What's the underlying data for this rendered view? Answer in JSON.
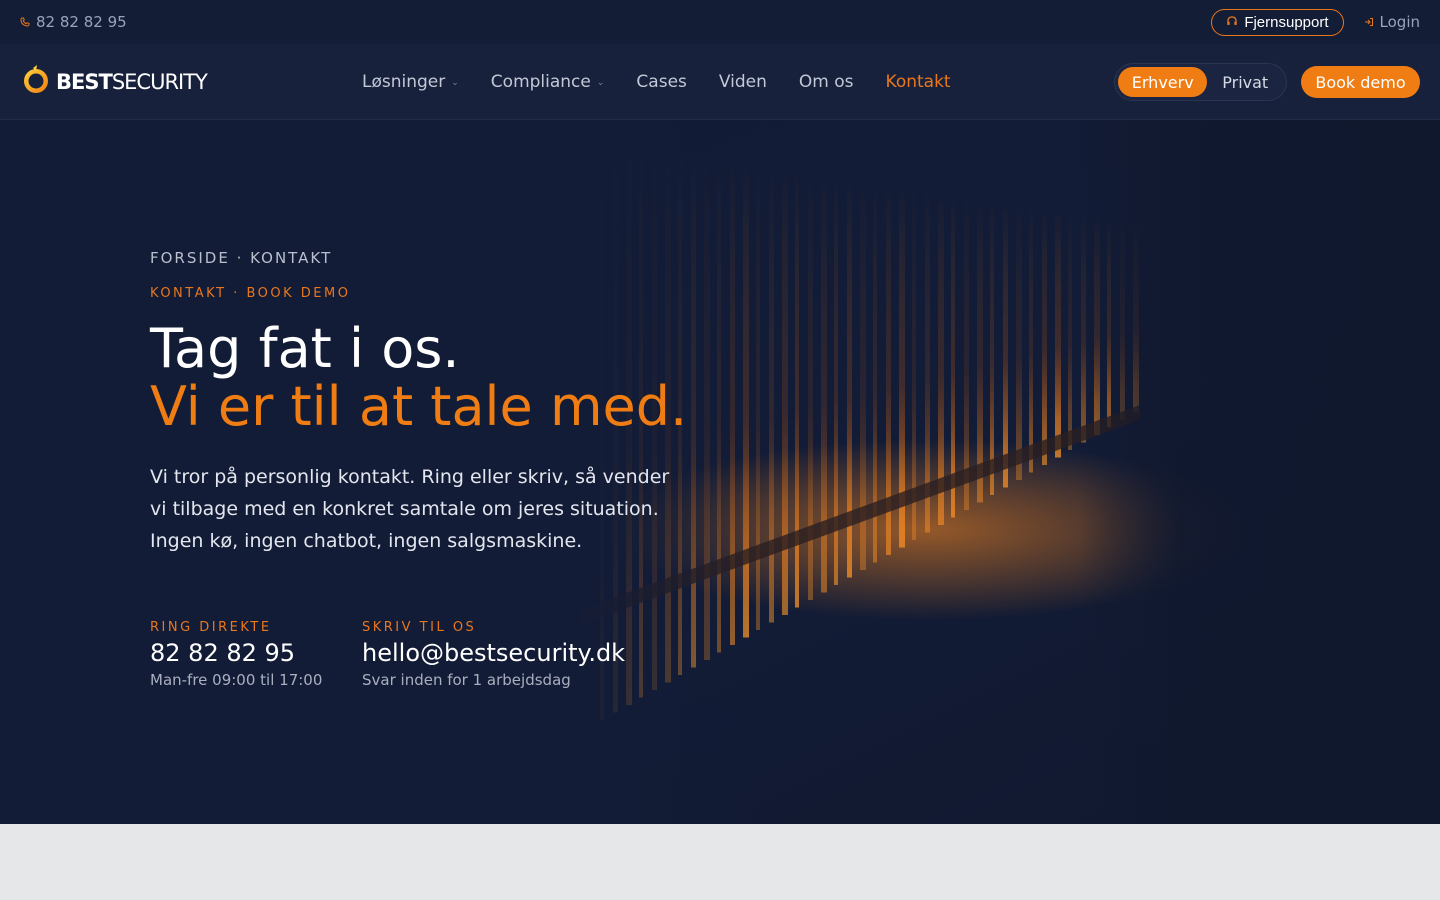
{
  "utility_bar": {
    "phone": "82 82 82 95",
    "support_label": "Fjernsupport",
    "login_label": "Login"
  },
  "nav": {
    "logo": {
      "best": "BEST",
      "security": "SECURITY"
    },
    "items": [
      {
        "label": "Løsninger",
        "has_dropdown": true
      },
      {
        "label": "Compliance",
        "has_dropdown": true
      },
      {
        "label": "Cases"
      },
      {
        "label": "Viden"
      },
      {
        "label": "Om os"
      },
      {
        "label": "Kontakt",
        "active": true
      }
    ],
    "segment": {
      "business": "Erhverv",
      "private": "Privat",
      "selected": "Erhverv"
    },
    "cta": "Book demo"
  },
  "hero": {
    "breadcrumb": "FORSIDE · KONTAKT",
    "eyebrow": "KONTAKT · BOOK DEMO",
    "title_line1": "Tag fat i os.",
    "title_line2": "Vi er til at tale med.",
    "intro": "Vi tror på personlig kontakt. Ring eller skriv, så vender vi tilbage med en konkret samtale om jeres situation. Ingen kø, ingen chatbot, ingen salgsmaskine.",
    "phone": {
      "label": "RING DIREKTE",
      "value": "82 82 82 95",
      "note": "Man-fre 09:00 til 17:00"
    },
    "email": {
      "label": "SKRIV TIL OS",
      "value": "hello@bestsecurity.dk",
      "note": "Svar inden for 1 arbejdsdag"
    }
  },
  "colors": {
    "accent": "#f07d13",
    "navy": "#131c36",
    "footer_band": "#e6e7e8"
  },
  "icons": [
    "phone-icon",
    "headset-icon",
    "login-icon",
    "chevron-down-icon"
  ]
}
